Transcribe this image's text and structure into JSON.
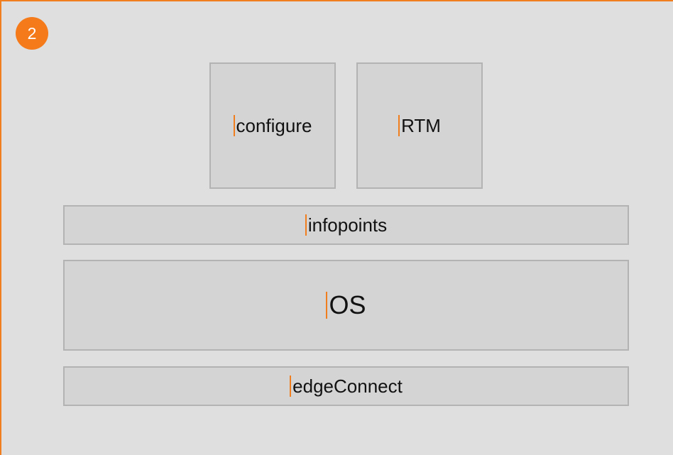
{
  "badge": {
    "number": "2"
  },
  "blocks": {
    "configure": "configure",
    "rtm": "RTM",
    "infopoints": "infopoints",
    "os": "OS",
    "edge_connect": "edgeConnect"
  },
  "colors": {
    "accent": "#f07d1e",
    "background": "#dfdfdf",
    "block_fill": "#d4d4d4",
    "block_border": "#b3b3b3"
  }
}
